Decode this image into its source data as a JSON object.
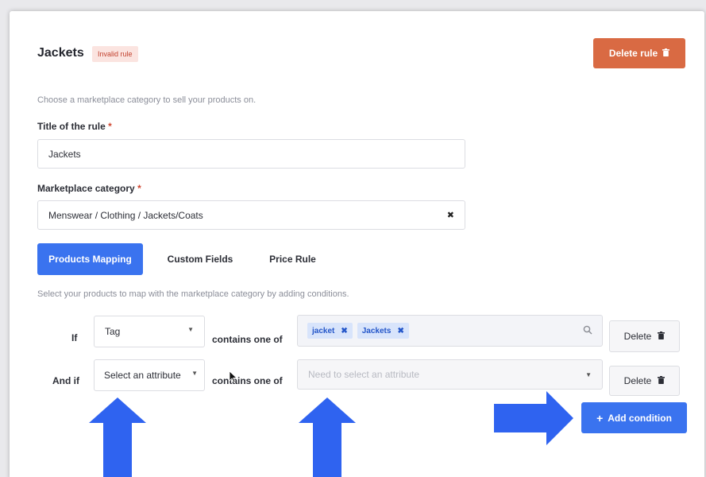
{
  "rule": {
    "title": "Jackets",
    "status_badge": "Invalid rule",
    "delete_rule_label": "Delete rule"
  },
  "intro_text": "Choose a marketplace category to sell your products on.",
  "title_field": {
    "label": "Title of the rule",
    "required_mark": "*",
    "value": "Jackets"
  },
  "category_field": {
    "label": "Marketplace category",
    "required_mark": "*",
    "value": "Menswear / Clothing / Jackets/Coats",
    "clear_glyph": "✖"
  },
  "tabs": [
    {
      "label": "Products Mapping",
      "active": true
    },
    {
      "label": "Custom Fields",
      "active": false
    },
    {
      "label": "Price Rule",
      "active": false
    }
  ],
  "mapping_help": "Select your products to map with the marketplace category by adding conditions.",
  "conditions": [
    {
      "prefix": "If",
      "attribute": "Tag",
      "operator": "contains one of",
      "values": [
        "jacket",
        "Jackets"
      ],
      "value_placeholder": "",
      "delete_label": "Delete"
    },
    {
      "prefix": "And if",
      "attribute": "Select an attribute",
      "operator": "contains one of",
      "values": [],
      "value_placeholder": "Need to select an attribute",
      "delete_label": "Delete"
    }
  ],
  "add_condition_label": "Add condition",
  "icons": {
    "trash": "trash-icon",
    "search": "search-icon",
    "caret": "chevron-down-icon",
    "chip_remove": "close-icon",
    "plus": "plus-icon",
    "annotation_arrow": "arrow-icon"
  },
  "colors": {
    "primary": "#3a73ef",
    "danger": "#d96a43",
    "badge_text": "#c2412e",
    "badge_bg": "#fbe4e0",
    "annotation_arrow": "#2f63f0"
  }
}
